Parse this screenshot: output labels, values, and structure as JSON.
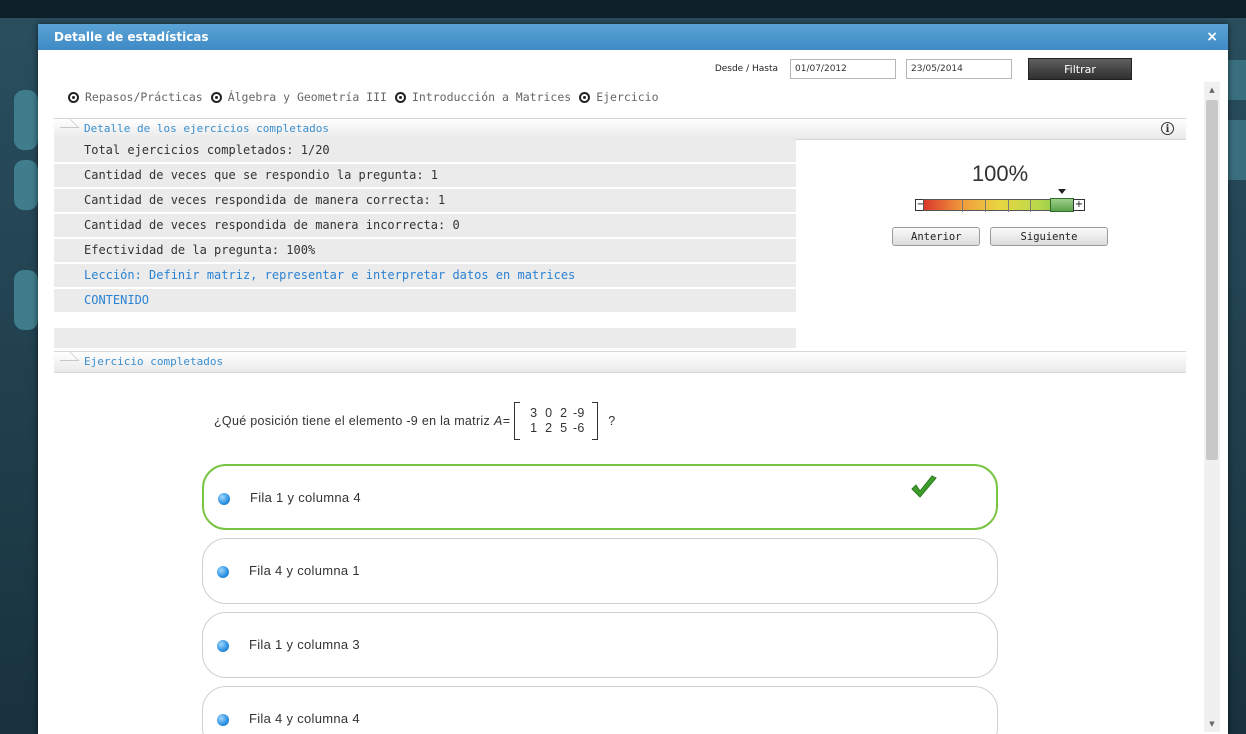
{
  "modal": {
    "title": "Detalle de estadísticas",
    "close_label": "×"
  },
  "filter": {
    "label": "Desde / Hasta",
    "from_value": "01/07/2012",
    "to_value": "23/05/2014",
    "button_label": "Filtrar"
  },
  "breadcrumb": [
    "Repasos/Prácticas",
    "Álgebra y Geometría III",
    "Introducción a Matrices",
    "Ejercicio"
  ],
  "details": {
    "header": "Detalle de los ejercicios completados",
    "rows": [
      "Total ejercicios completados: 1/20",
      "Cantidad de veces que se respondio la pregunta: 1",
      "Cantidad de veces respondida de manera correcta: 1",
      "Cantidad de veces respondida de manera incorrecta: 0",
      "Efectividad de la pregunta: 100%"
    ],
    "lesson_link": "Lección: Definir matriz, representar e interpretar datos en matrices",
    "content_link": "CONTENIDO",
    "percent": "100%",
    "meter_level": 0.9,
    "prev_label": "Anterior",
    "next_label": "Siguiente"
  },
  "exercise": {
    "header": "Ejercicio completados",
    "question_prefix": "¿Qué posición tiene el elemento -9 en la matriz",
    "matrix_name": "A=",
    "matrix": [
      [
        "3",
        "0",
        "2",
        "-9"
      ],
      [
        "1",
        "2",
        "5",
        "-6"
      ]
    ],
    "question_suffix": "?",
    "options": [
      {
        "label": "Fila 1 y columna 4",
        "correct": true
      },
      {
        "label": "Fila 4 y columna 1",
        "correct": false
      },
      {
        "label": "Fila 1 y columna 3",
        "correct": false
      },
      {
        "label": "Fila 4 y columna 4",
        "correct": false
      }
    ]
  },
  "colors": {
    "titlebar": "#3f8ac6",
    "link": "#2a82d3",
    "correct_border": "#79c442",
    "check": "#3f9e2b"
  },
  "icons": {
    "close": "close-icon",
    "breadcrumb": "eye-icon",
    "info": "info-icon",
    "check": "check-icon",
    "radio": "radio-dot-icon"
  }
}
